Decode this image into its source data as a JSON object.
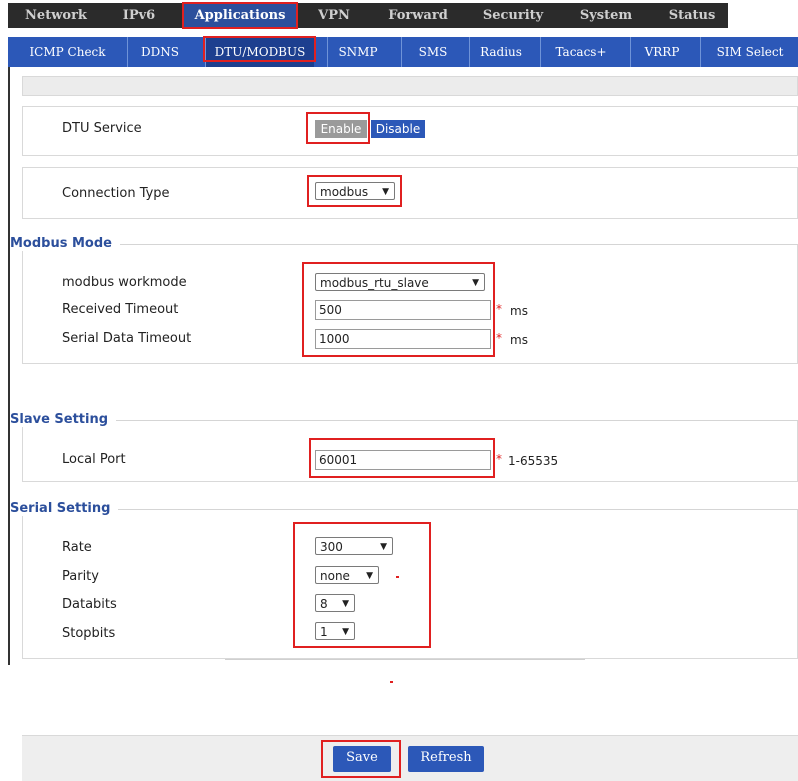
{
  "top_tabs": [
    "Network",
    "IPv6",
    "Applications",
    "VPN",
    "Forward",
    "Security",
    "System",
    "Status"
  ],
  "sub_tabs": [
    "ICMP Check",
    "DDNS",
    "DTU/MODBUS",
    "SNMP",
    "SMS",
    "Radius",
    "Tacacs+",
    "VRRP",
    "SIM Select"
  ],
  "dtu": {
    "label": "DTU Service",
    "enable": "Enable",
    "disable": "Disable"
  },
  "connection": {
    "label": "Connection Type",
    "value": "modbus"
  },
  "modbus": {
    "legend": "Modbus Mode",
    "workmode_label": "modbus workmode",
    "workmode_value": "modbus_rtu_slave",
    "recv_label": "Received Timeout",
    "recv_value": "500",
    "recv_unit": "ms",
    "serial_label": "Serial Data Timeout",
    "serial_value": "1000",
    "serial_unit": "ms",
    "required_mark": "*"
  },
  "slave": {
    "legend": "Slave Setting",
    "port_label": "Local Port",
    "port_value": "60001",
    "port_range": "1-65535"
  },
  "serial": {
    "legend": "Serial Setting",
    "rate_label": "Rate",
    "rate_value": "300",
    "parity_label": "Parity",
    "parity_value": "none",
    "databits_label": "Databits",
    "databits_value": "8",
    "stopbits_label": "Stopbits",
    "stopbits_value": "1"
  },
  "footer": {
    "save": "Save",
    "refresh": "Refresh"
  },
  "colors": {
    "accent": "#2c58b8",
    "highlight": "#e02020",
    "dark_nav": "#2b2b2b",
    "legend": "#2c4f9c"
  }
}
